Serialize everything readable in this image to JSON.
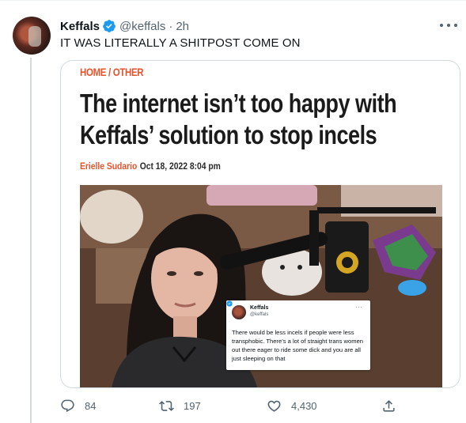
{
  "author": {
    "name": "Keffals",
    "handle": "@keffals",
    "separator": "·",
    "time": "2h"
  },
  "tweet": {
    "text": "IT WAS LITERALLY A SHITPOST COME ON"
  },
  "article": {
    "breadcrumb": "HOME / OTHER",
    "headline": "The internet isn’t too happy with Keffals’ solution to stop incels",
    "byline_author": "Erielle Sudario",
    "byline_date": "Oct 18, 2022 8:04 pm"
  },
  "embedded_tweet": {
    "name": "Keffals",
    "handle": "@keffals",
    "more": "···",
    "text": "There would be less incels if people were less transphobic. There’s a lot of straight trans women out there eager to ride some dick and you are all just sleeping on that"
  },
  "actions": {
    "reply_count": "84",
    "retweet_count": "197",
    "like_count": "4,430"
  },
  "colors": {
    "verified": "#1d9bf0",
    "accent_orange": "#e8522b",
    "icon_gray": "#536471"
  },
  "icons": [
    "verified-badge-icon",
    "more-options-icon",
    "reply-icon",
    "retweet-icon",
    "like-icon",
    "share-icon"
  ]
}
